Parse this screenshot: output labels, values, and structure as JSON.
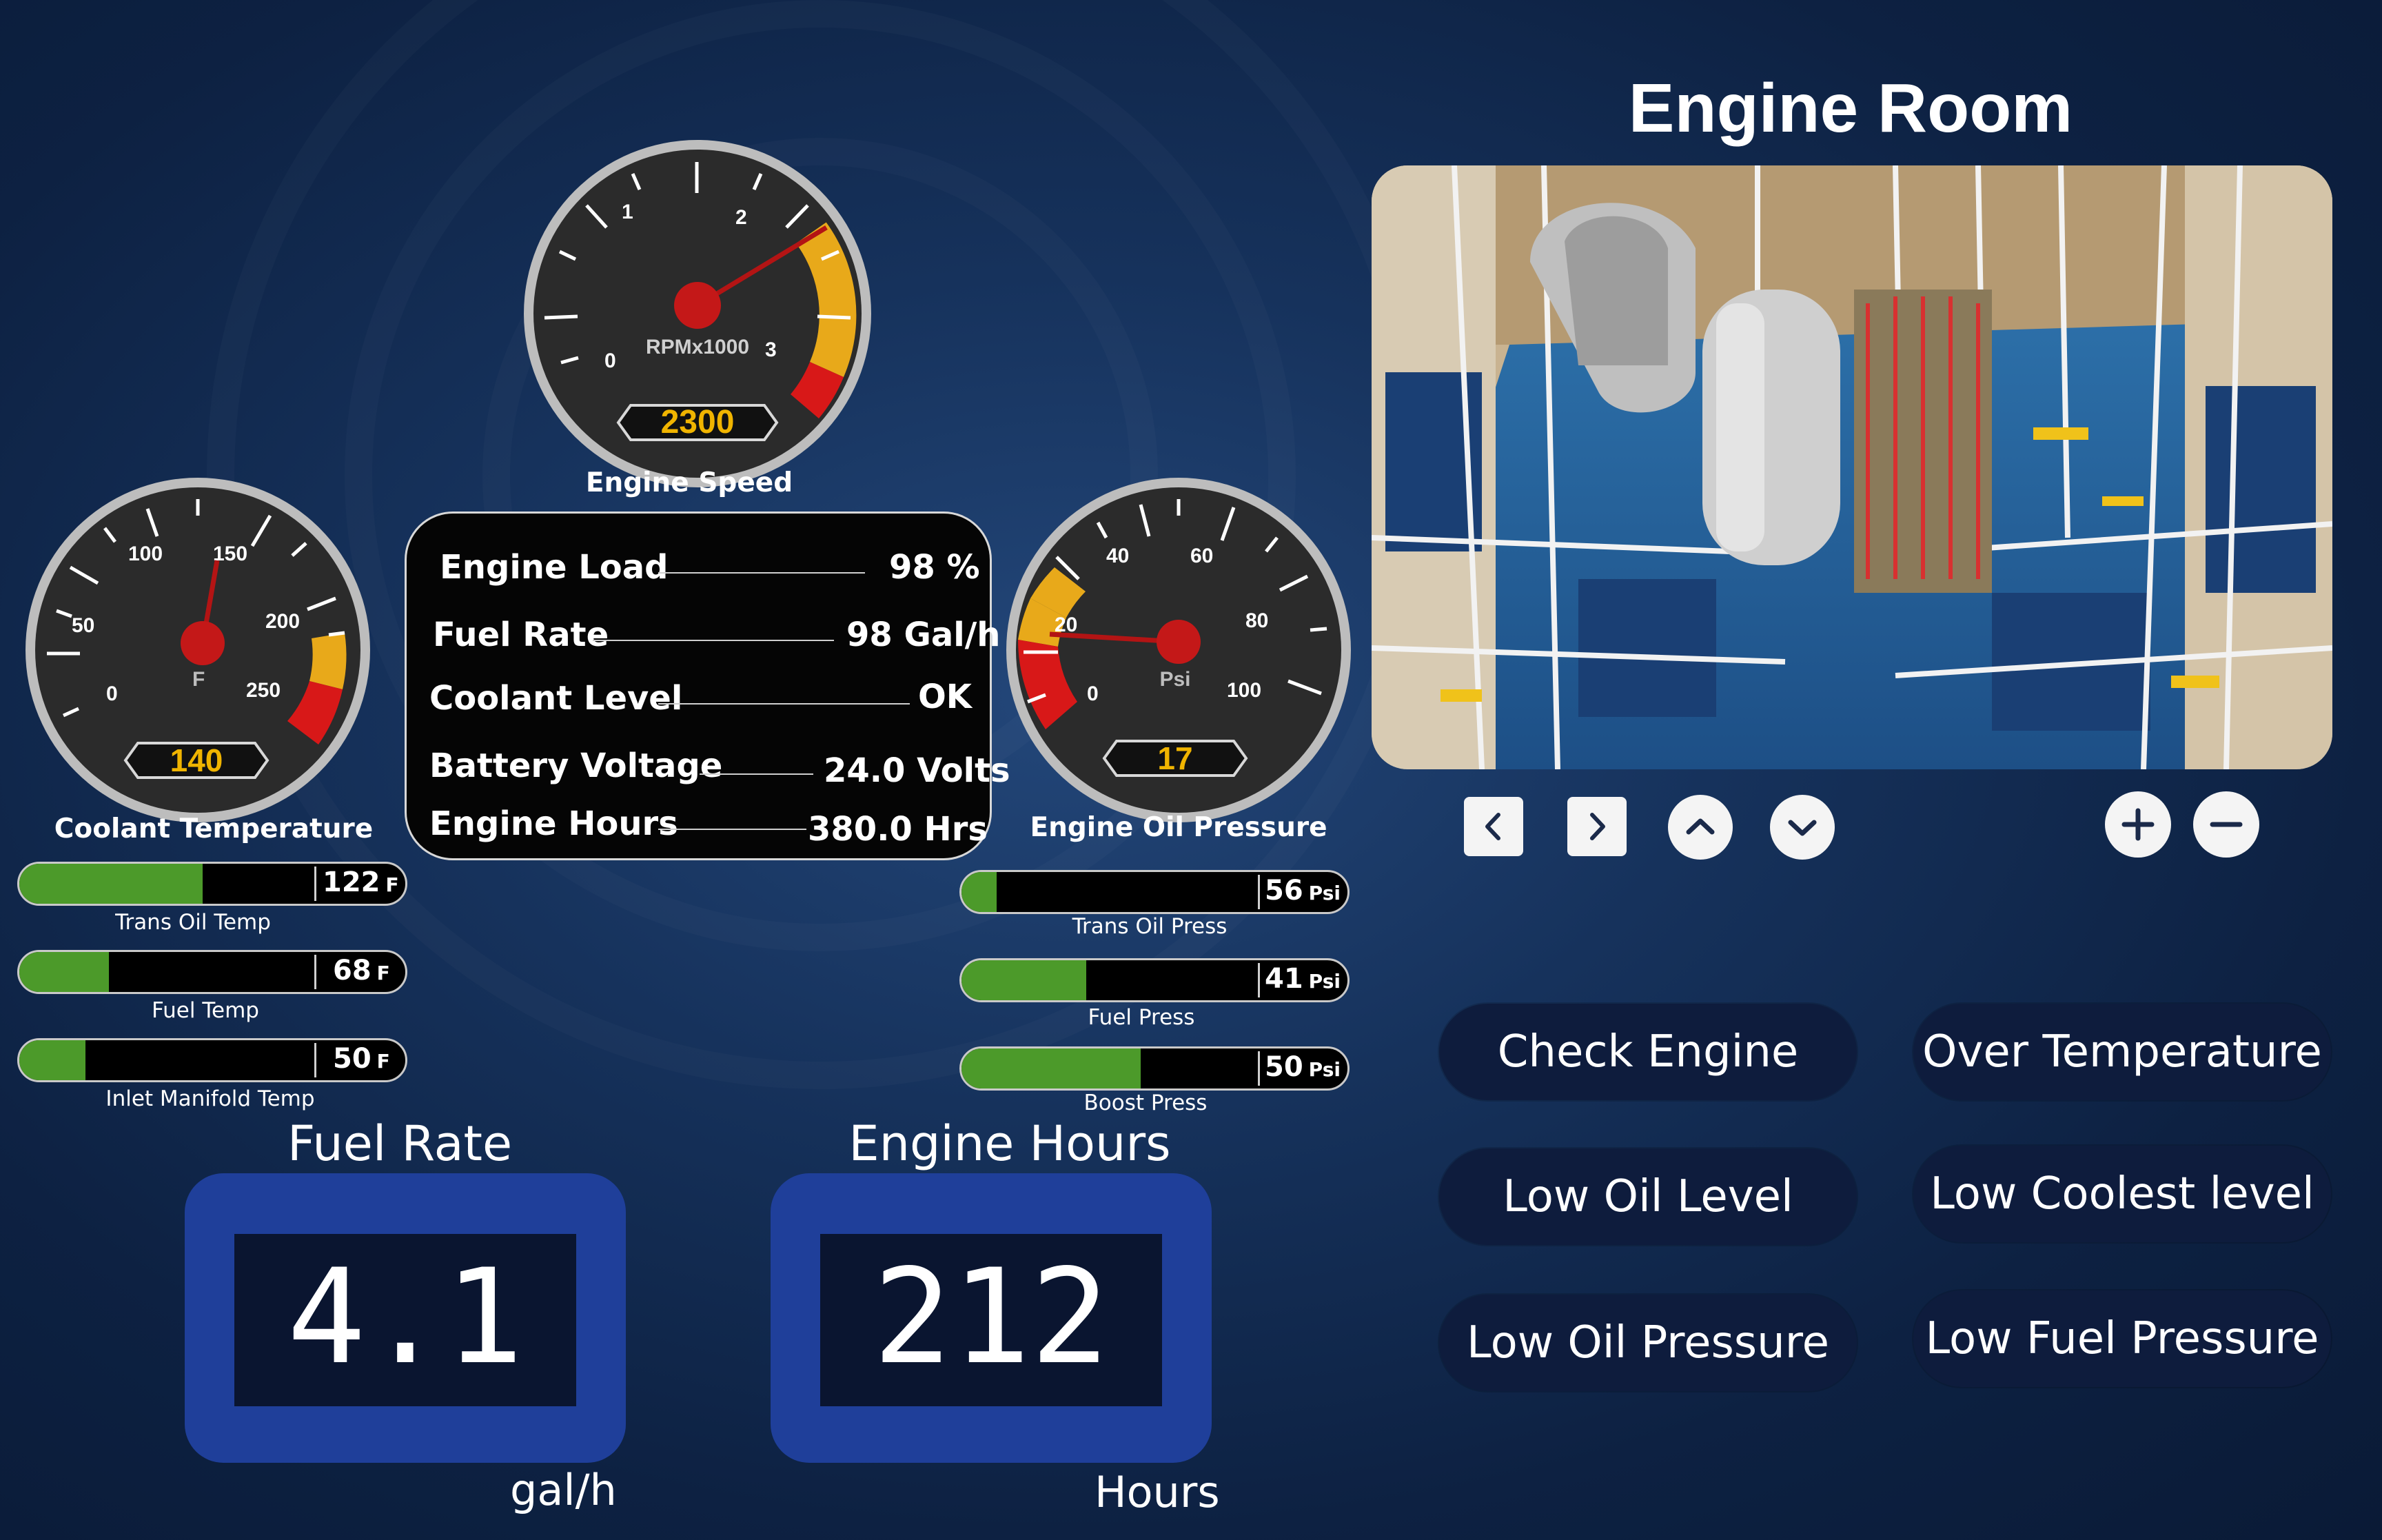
{
  "page": {
    "title": "Engine Room"
  },
  "gauges": {
    "engine_speed": {
      "label": "Engine Speed",
      "unit": "RPMx1000",
      "ticks": [
        "0",
        "1",
        "2",
        "3"
      ],
      "value": "2300"
    },
    "coolant": {
      "label": "Coolant Temperature",
      "unit": "F",
      "ticks": [
        "0",
        "50",
        "100",
        "150",
        "200",
        "250"
      ],
      "value": "140"
    },
    "oil_pressure": {
      "label": "Engine Oil Pressure",
      "unit": "Psi",
      "ticks": [
        "0",
        "20",
        "40",
        "60",
        "80",
        "100"
      ],
      "value": "17"
    }
  },
  "info_panel": [
    {
      "label": "Engine Load",
      "value": "98 %"
    },
    {
      "label": "Fuel Rate",
      "value": "98 Gal/h"
    },
    {
      "label": "Coolant Level",
      "value": "OK"
    },
    {
      "label": "Battery Voltage",
      "value": "24.0 Volts"
    },
    {
      "label": "Engine Hours",
      "value": "380.0 Hrs"
    }
  ],
  "bars_left": [
    {
      "label": "Trans Oil Temp",
      "value": "122",
      "unit": "F",
      "fill_fraction": 0.47
    },
    {
      "label": "Fuel Temp",
      "value": "68",
      "unit": "F",
      "fill_fraction": 0.23
    },
    {
      "label": "Inlet Manifold Temp",
      "value": "50",
      "unit": "F",
      "fill_fraction": 0.17
    }
  ],
  "bars_right": [
    {
      "label": "Trans Oil Press",
      "value": "56",
      "unit": "Psi",
      "fill_fraction": 0.09
    },
    {
      "label": "Fuel Press",
      "value": "41",
      "unit": "Psi",
      "fill_fraction": 0.32
    },
    {
      "label": "Boost Press",
      "value": "50",
      "unit": "Psi",
      "fill_fraction": 0.46
    }
  ],
  "readouts": {
    "fuel_rate": {
      "title": "Fuel Rate",
      "value": "4.1",
      "unit": "gal/h"
    },
    "engine_hours": {
      "title": "Engine Hours",
      "value": "212",
      "unit": "Hours"
    }
  },
  "camera_controls": [
    "chevron-left-icon",
    "chevron-right-icon",
    "chevron-up-icon",
    "chevron-down-icon",
    "zoom-in-icon",
    "zoom-out-icon"
  ],
  "alarms": [
    "Check Engine",
    "Over Temperature",
    "Low Oil Level",
    "Low Coolest level",
    "Low Oil Pressure",
    "Low Fuel Pressure"
  ],
  "colors": {
    "bar_fill": "#4c9a2a",
    "gauge_yellow": "#e8a91a",
    "gauge_red": "#d81818",
    "needle": "#c41818",
    "readout_frame": "#1f3f9a"
  }
}
